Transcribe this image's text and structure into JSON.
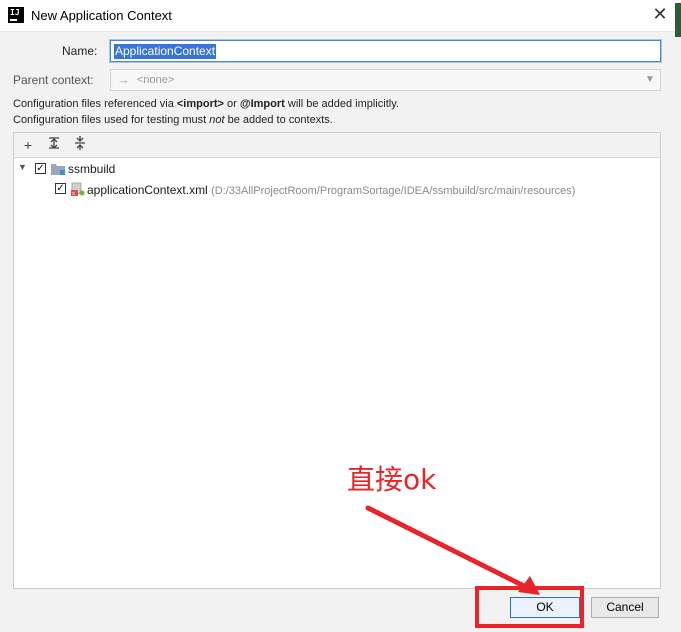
{
  "window": {
    "title": "New Application Context",
    "app_icon_text": "IJ"
  },
  "form": {
    "name_label": "Name:",
    "name_value": "ApplicationContext",
    "parent_label": "Parent context:",
    "parent_value": "<none>"
  },
  "info": {
    "line1_prefix": "Configuration files referenced via ",
    "line1_bold1": "<import>",
    "line1_mid": " or ",
    "line1_bold2": "@Import",
    "line1_suffix": " will be added implicitly.",
    "line2_prefix": "Configuration files used for testing must ",
    "line2_italic": "not",
    "line2_suffix": " be added to contexts."
  },
  "toolbar": {
    "add_icon": "plus-icon",
    "expand_icon": "expand-all-icon",
    "collapse_icon": "collapse-all-icon"
  },
  "tree": {
    "module": {
      "label": "ssmbuild",
      "checked": true,
      "expanded": true
    },
    "file": {
      "label": "applicationContext.xml",
      "path": "(D:/33AllProjectRoom/ProgramSortage/IDEA/ssmbuild/src/main/resources)",
      "checked": true
    }
  },
  "buttons": {
    "ok": "OK",
    "cancel": "Cancel"
  },
  "annotation": {
    "text": "直接ok",
    "color": "#e8242a"
  },
  "colors": {
    "selection": "#3875d7",
    "focus_border": "#4a88c7"
  }
}
